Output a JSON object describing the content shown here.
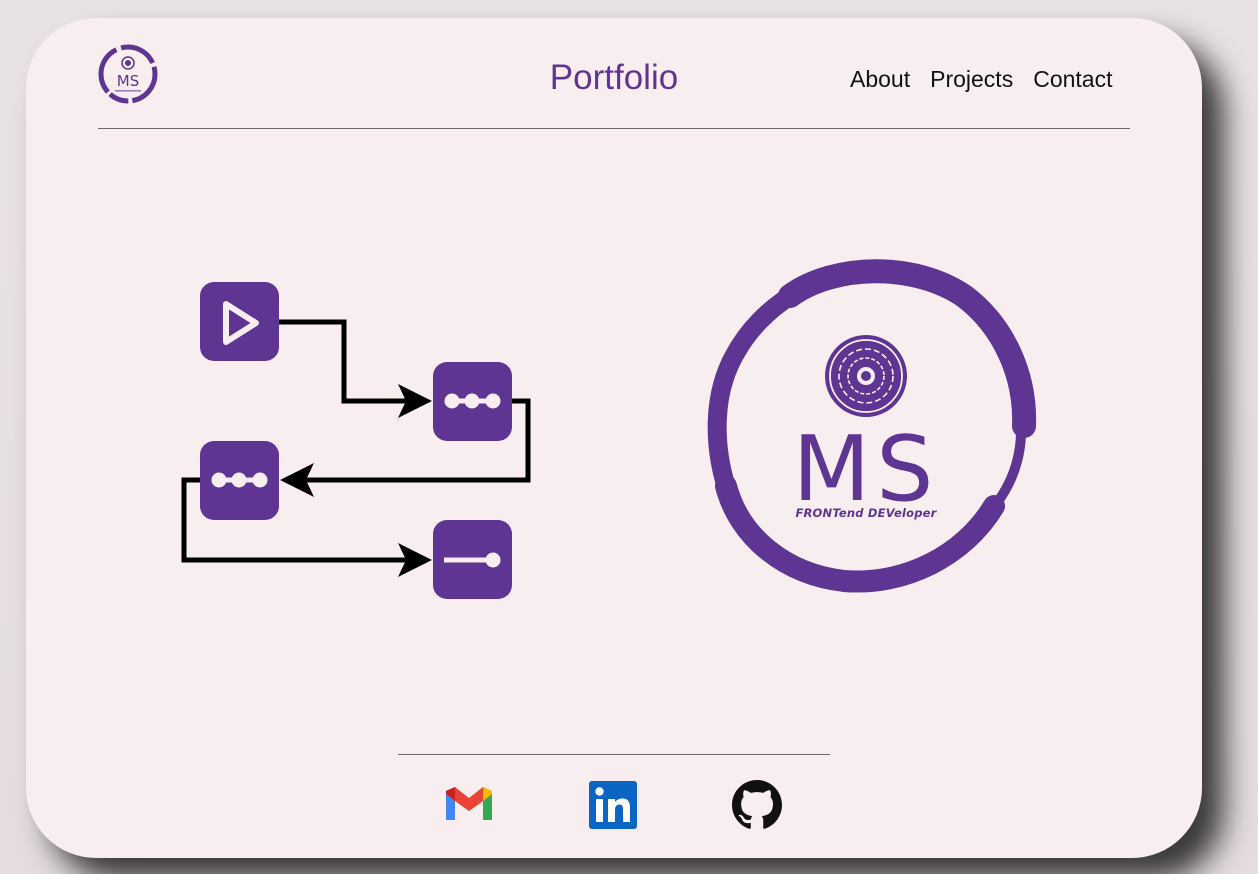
{
  "header": {
    "logo_alt": "MS",
    "logo_tagline": "FRONTend DEVeloper",
    "title": "Portfolio"
  },
  "nav": {
    "items": [
      {
        "label": "About"
      },
      {
        "label": "Projects"
      },
      {
        "label": "Contact"
      }
    ]
  },
  "hero": {
    "brand_text": "MS",
    "brand_tagline": "FRONTend DEVeloper"
  },
  "footer": {
    "social": [
      {
        "name": "gmail-icon"
      },
      {
        "name": "linkedin-icon"
      },
      {
        "name": "github-icon"
      }
    ]
  },
  "colors": {
    "card_bg": "#f8eef0",
    "accent": "#5e3593",
    "text": "#111111",
    "divider": "#6f6a6c"
  }
}
